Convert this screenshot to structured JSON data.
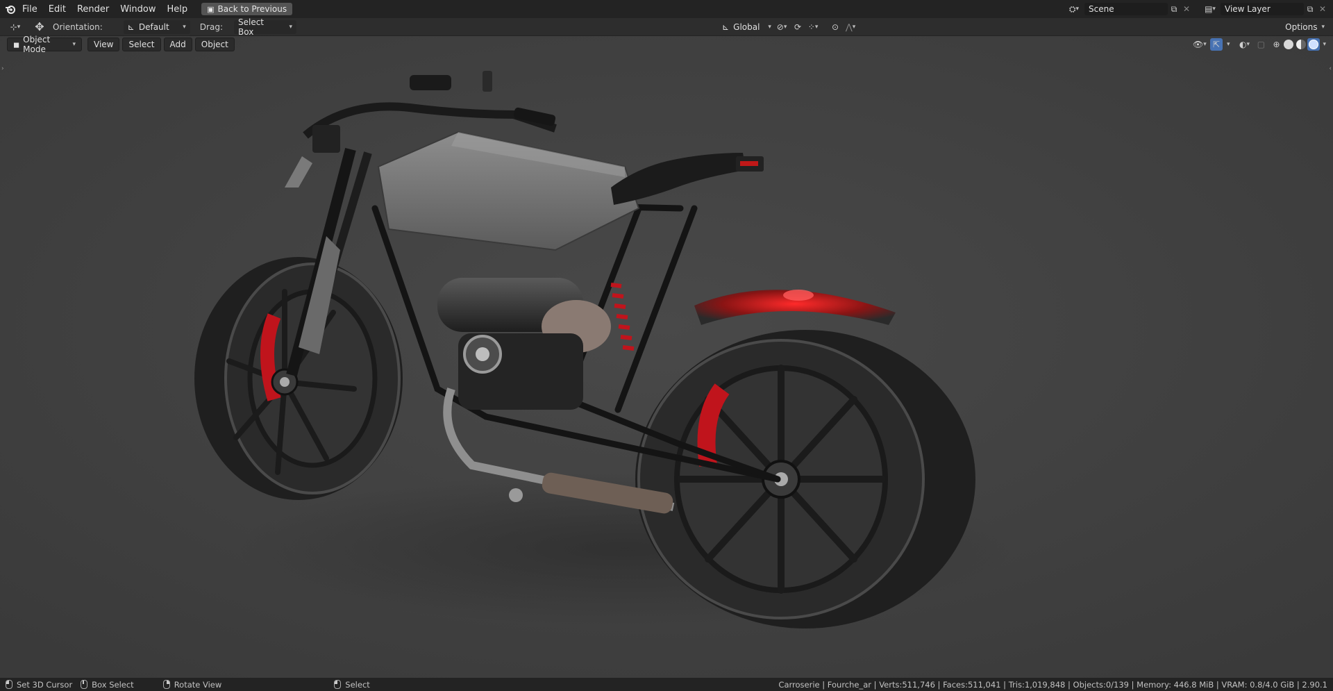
{
  "topbar": {
    "menu": [
      "File",
      "Edit",
      "Render",
      "Window",
      "Help"
    ],
    "back_button": "Back to Previous",
    "scene": "Scene",
    "view_layer": "View Layer"
  },
  "toolheader": {
    "orientation_label": "Orientation:",
    "orientation_value": "Default",
    "drag_label": "Drag:",
    "drag_value": "Select Box",
    "transform_orientation": "Global",
    "options_label": "Options"
  },
  "viewport_header": {
    "mode": "Object Mode",
    "menus": [
      "View",
      "Select",
      "Add",
      "Object"
    ]
  },
  "statusbar": {
    "hints": [
      {
        "icon": "mouse-left-icon",
        "label": "Set 3D Cursor"
      },
      {
        "icon": "mouse-middle-icon",
        "label": "Box Select"
      },
      {
        "icon": "mouse-right-icon",
        "label": "Rotate View"
      },
      {
        "icon": "mouse-left-icon",
        "label": "Select"
      }
    ],
    "stats": "Carroserie | Fourche_ar | Verts:511,746 | Faces:511,041 | Tris:1,019,848 | Objects:0/139 | Memory: 446.8 MiB | VRAM: 0.8/4.0 GiB | 2.90.1"
  },
  "colors": {
    "accent": "#4772b3",
    "brake_red": "#c0141c",
    "viewport_bg": "#3e3e3e"
  }
}
